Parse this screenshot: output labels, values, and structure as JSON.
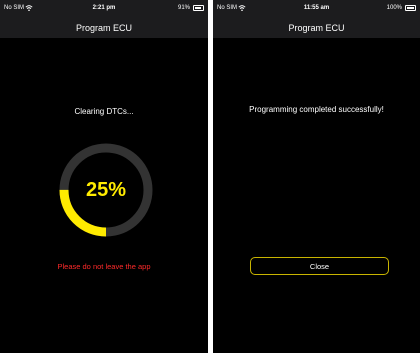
{
  "colors": {
    "accent": "#ffeb00",
    "ring_track": "#333333",
    "warning": "#ff2a2a",
    "button_border": "#c8b400",
    "background": "#000000"
  },
  "screens": [
    {
      "status_bar": {
        "carrier": "No SIM",
        "time": "2:21 pm",
        "battery": "91%",
        "battery_level": 0.91
      },
      "nav_title": "Program ECU",
      "message": "Clearing DTCs...",
      "progress": {
        "value": 25,
        "label": "25%"
      },
      "warning": "Please do not leave the app"
    },
    {
      "status_bar": {
        "carrier": "No SIM",
        "time": "11:55 am",
        "battery": "100%",
        "battery_level": 1.0
      },
      "nav_title": "Program ECU",
      "message": "Programming completed successfully!",
      "close_label": "Close"
    }
  ]
}
